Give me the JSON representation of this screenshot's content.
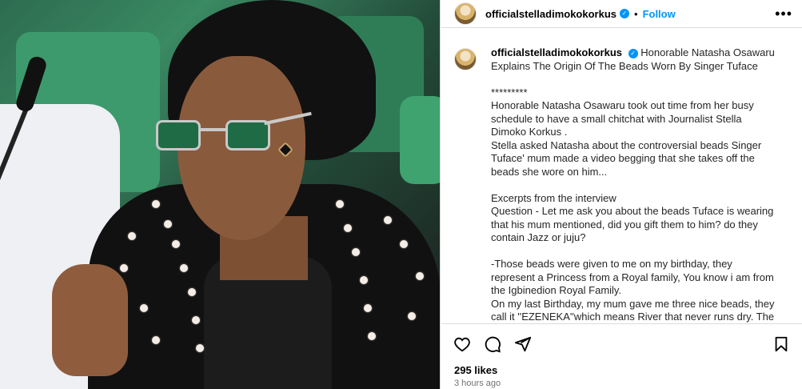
{
  "post": {
    "username": "officialstelladimokokorkus",
    "follow_label": "Follow",
    "separator": "•",
    "more_label": "•••"
  },
  "caption": {
    "username": "officialstelladimokokorkus",
    "title": "Honorable Natasha Osawaru Explains The Origin Of The Beads Worn By Singer Tuface",
    "lines": [
      "*********",
      "Honorable Natasha Osawaru took out time from her busy schedule to have a small chitchat with Journalist Stella Dimoko Korkus .",
      "Stella asked Natasha about the controversial beads Singer Tuface' mum made a video begging that she takes off the beads she wore on him...",
      "",
      "Excerpts from the interview",
      "Question - Let me ask you about the beads Tuface is wearing that his mum mentioned, did you gift them to him? do they contain Jazz or juju?",
      "",
      "-Those beads were given to me on my birthday, they represent a Princess from a Royal family, You know i am from the Igbinedion Royal Family.",
      "On my last Birthday, my mum gave me three nice beads, they call it ''EZENEKA''which means River that never runs dry. The pearl on it is the pearl that never runs dry in the waters of Benin..."
    ]
  },
  "icons": {
    "like": "heart-icon",
    "comment": "comment-icon",
    "share": "share-icon",
    "save": "bookmark-icon",
    "verified": "verified-badge-icon"
  },
  "stats": {
    "likes": "295 likes",
    "time": "3 hours ago"
  },
  "colors": {
    "accent": "#0095f6",
    "border": "#dbdbdb",
    "muted": "#737373"
  }
}
